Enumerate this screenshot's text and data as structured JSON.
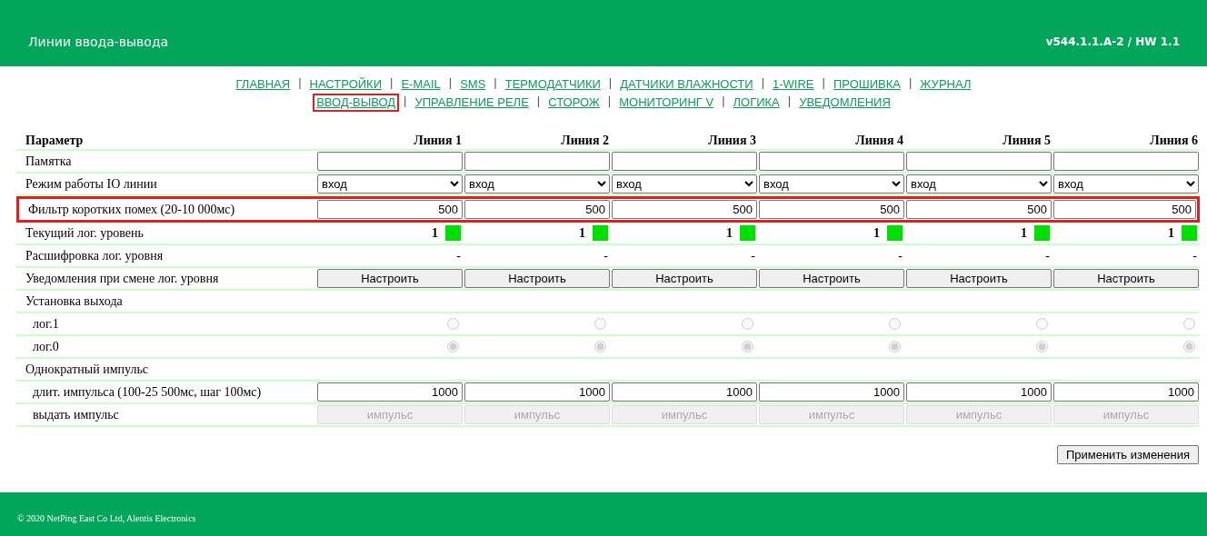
{
  "header": {
    "title": "Линии ввода-вывода",
    "version": "v544.1.1.A-2 / HW 1.1"
  },
  "nav": {
    "separator": "|",
    "lines": [
      [
        {
          "label": "ГЛАВНАЯ",
          "selected": false
        },
        {
          "label": "НАСТРОЙКИ",
          "selected": false
        },
        {
          "label": "E-MAIL",
          "selected": false
        },
        {
          "label": "SMS",
          "selected": false
        },
        {
          "label": "ТЕРМОДАТЧИКИ",
          "selected": false
        },
        {
          "label": "ДАТЧИКИ ВЛАЖНОСТИ",
          "selected": false
        },
        {
          "label": "1-WIRE",
          "selected": false
        },
        {
          "label": "ПРОШИВКА",
          "selected": false
        },
        {
          "label": "ЖУРНАЛ",
          "selected": false
        }
      ],
      [
        {
          "label": "ВВОД-ВЫВОД",
          "selected": true
        },
        {
          "label": "УПРАВЛЕНИЕ РЕЛЕ",
          "selected": false
        },
        {
          "label": "СТОРОЖ",
          "selected": false
        },
        {
          "label": "МОНИТОРИНГ V",
          "selected": false
        },
        {
          "label": "ЛОГИКА",
          "selected": false
        },
        {
          "label": "УВЕДОМЛЕНИЯ",
          "selected": false
        }
      ]
    ]
  },
  "table": {
    "columns": [
      "Параметр",
      "Линия 1",
      "Линия 2",
      "Линия 3",
      "Линия 4",
      "Линия 5",
      "Линия 6"
    ],
    "rows": [
      {
        "kind": "text-input",
        "label": "Памятка",
        "highlighted": false
      },
      {
        "kind": "select",
        "label": "Режим работы IO линии",
        "highlighted": false,
        "values": [
          "вход",
          "вход",
          "вход",
          "вход",
          "вход",
          "вход"
        ]
      },
      {
        "kind": "number-input",
        "label": "Фильтр коротких помех (20-10 000мс)",
        "highlighted": true,
        "values": [
          "500",
          "500",
          "500",
          "500",
          "500",
          "500"
        ]
      },
      {
        "kind": "level",
        "label": "Текущий лог. уровень",
        "highlighted": false,
        "cells": [
          {
            "value": "1",
            "color": "#00e000"
          },
          {
            "value": "1",
            "color": "#00e000"
          },
          {
            "value": "1",
            "color": "#00e000"
          },
          {
            "value": "1",
            "color": "#00e000"
          },
          {
            "value": "1",
            "color": "#00e000"
          },
          {
            "value": "1",
            "color": "#00e000"
          }
        ]
      },
      {
        "kind": "text",
        "label": "Расшифровка лог. уровня",
        "highlighted": false,
        "values": [
          "-",
          "-",
          "-",
          "-",
          "-",
          "-"
        ]
      },
      {
        "kind": "button",
        "label": "Уведомления при смене лог. уровня",
        "highlighted": false,
        "disabled": false,
        "values": [
          "Настроить",
          "Настроить",
          "Настроить",
          "Настроить",
          "Настроить",
          "Настроить"
        ]
      },
      {
        "kind": "section",
        "label": "Установка выхода",
        "highlighted": false,
        "children": [
          {
            "kind": "radio",
            "label": "лог.1",
            "highlighted": false,
            "disabled": true,
            "cells": [
              {
                "selected": false
              },
              {
                "selected": false
              },
              {
                "selected": false
              },
              {
                "selected": false
              },
              {
                "selected": false
              },
              {
                "selected": false
              }
            ]
          },
          {
            "kind": "radio",
            "label": "лог.0",
            "highlighted": false,
            "disabled": true,
            "cells": [
              {
                "selected": true
              },
              {
                "selected": true
              },
              {
                "selected": true
              },
              {
                "selected": true
              },
              {
                "selected": true
              },
              {
                "selected": true
              }
            ]
          }
        ]
      },
      {
        "kind": "section",
        "label": "Однократный импульс",
        "highlighted": false,
        "children": [
          {
            "kind": "number-input",
            "label": "длит. импульса (100-25 500мс, шаг 100мс)",
            "highlighted": false,
            "values": [
              "1000",
              "1000",
              "1000",
              "1000",
              "1000",
              "1000"
            ]
          },
          {
            "kind": "button",
            "label": "выдать импульс",
            "highlighted": false,
            "disabled": true,
            "values": [
              "импульс",
              "импульс",
              "импульс",
              "импульс",
              "импульс",
              "импульс"
            ]
          }
        ]
      }
    ]
  },
  "apply_button": "Применить изменения",
  "footer": "© 2020 NetPing East Co Ltd, Alentis Electronics"
}
